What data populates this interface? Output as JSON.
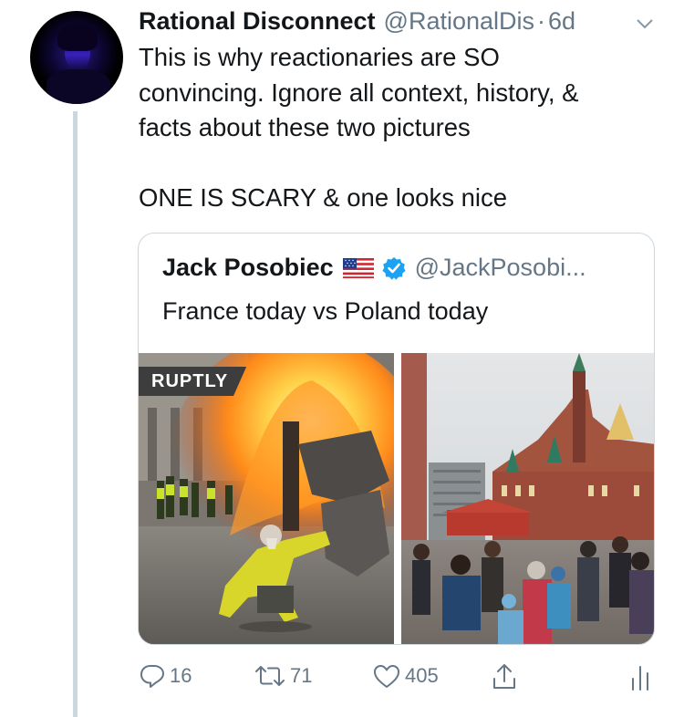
{
  "tweet": {
    "display_name": "Rational Disconnect",
    "handle": "@RationalDis",
    "separator": "·",
    "time": "6d",
    "text_line1": "This is why reactionaries are SO",
    "text_line2": "convincing. Ignore all context, history, &",
    "text_line3": "facts about these two pictures",
    "text_line4": "ONE IS SCARY & one looks nice"
  },
  "quote": {
    "display_name": "Jack Posobiec",
    "handle": "@JackPosobi...",
    "text": "France today vs Poland today",
    "flag_icon": "us-flag-icon",
    "verified_color": "#1da1f2",
    "media": [
      {
        "watermark": "RUPTLY",
        "icon": "photo-protest-fire"
      },
      {
        "icon": "photo-christmas-market"
      }
    ]
  },
  "actions": {
    "reply_count": "16",
    "retweet_count": "71",
    "like_count": "405"
  },
  "colors": {
    "text": "#14171a",
    "muted": "#657786",
    "border": "#ccd6dd",
    "accent": "#1da1f2"
  }
}
